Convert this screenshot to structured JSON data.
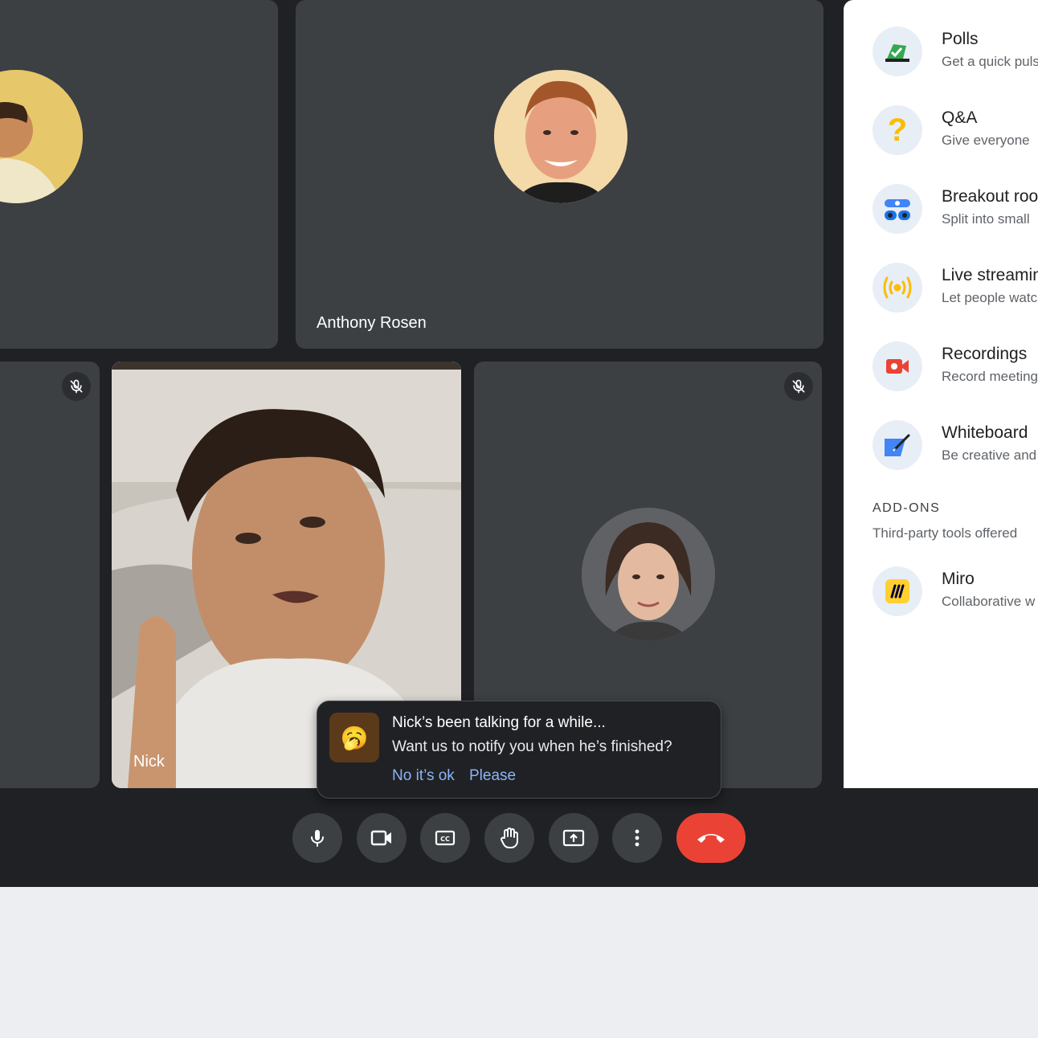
{
  "participants": [
    {
      "name": ""
    },
    {
      "name": "Anthony Rosen"
    },
    {
      "name": ""
    },
    {
      "name": "Nick"
    },
    {
      "name": ""
    }
  ],
  "toast": {
    "title": "Nick’s been talking for a while...",
    "message": "Want us to notify you when he’s finished?",
    "dismiss_label": "No it’s ok",
    "confirm_label": "Please",
    "emoji": "🥱"
  },
  "activities": {
    "items": [
      {
        "title": "Polls",
        "description": "Get a quick pulse",
        "icon": "polls-icon"
      },
      {
        "title": "Q&A",
        "description": "Give everyone",
        "icon": "question-icon"
      },
      {
        "title": "Breakout rooms",
        "description": "Split into small",
        "icon": "breakout-rooms-icon"
      },
      {
        "title": "Live streaming",
        "description": "Let people watch",
        "icon": "live-stream-icon"
      },
      {
        "title": "Recordings",
        "description": "Record meeting",
        "icon": "record-icon"
      },
      {
        "title": "Whiteboard",
        "description": "Be creative and",
        "icon": "whiteboard-icon"
      }
    ],
    "addons_heading": "ADD-ONS",
    "addons_desc": "Third-party tools offered",
    "addons": [
      {
        "title": "Miro",
        "description": "Collaborative w",
        "icon": "miro-icon"
      }
    ]
  },
  "controls": [
    "mic-icon",
    "camera-icon",
    "captions-icon",
    "raise-hand-icon",
    "present-icon",
    "more-icon",
    "end-call-icon"
  ],
  "colors": {
    "accent": "#8ab4f8",
    "end_call": "#ea4335",
    "tile": "#3c4043",
    "stage": "#202124"
  }
}
